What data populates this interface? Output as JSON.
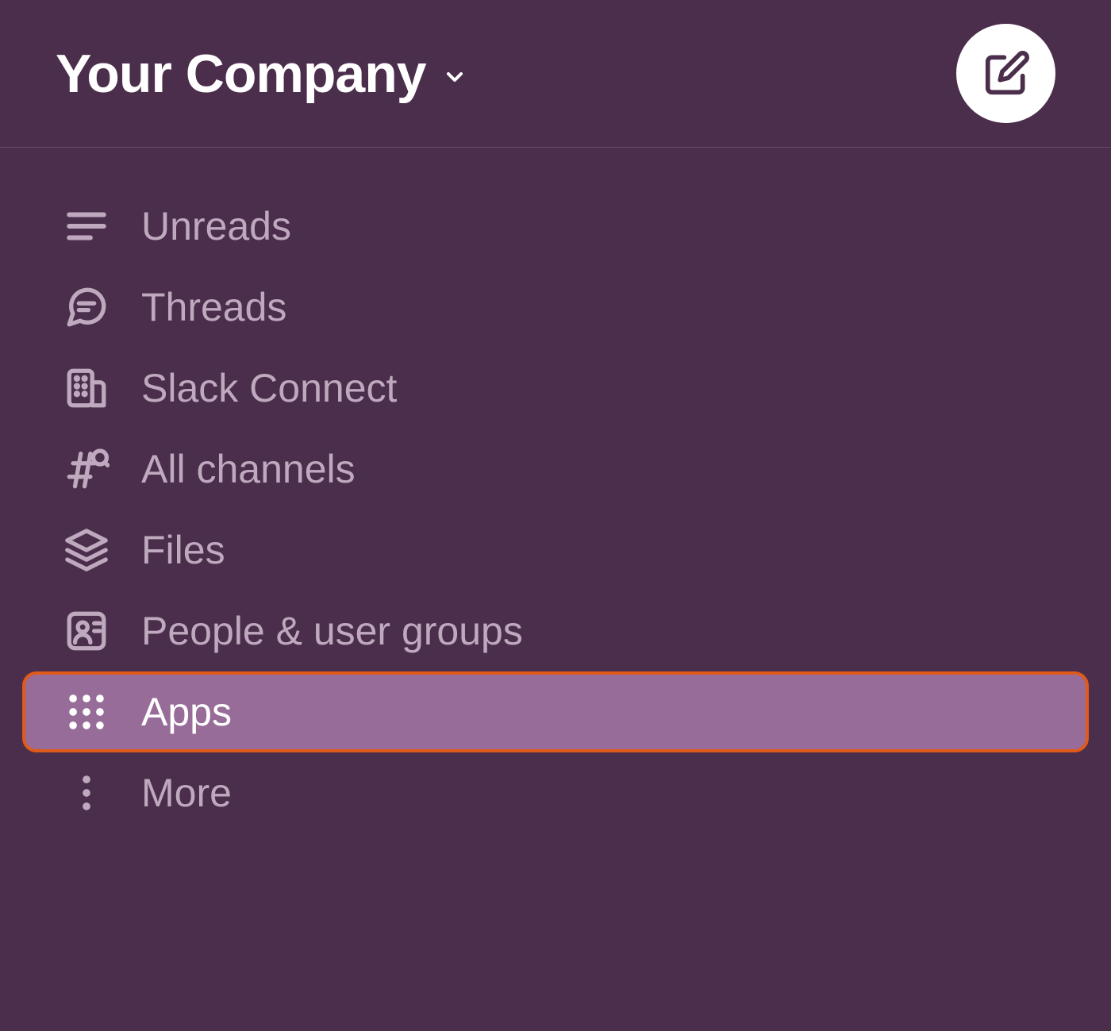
{
  "header": {
    "workspace_name": "Your Company"
  },
  "sidebar": {
    "items": [
      {
        "label": "Unreads",
        "icon": "unreads-icon",
        "selected": false
      },
      {
        "label": "Threads",
        "icon": "threads-icon",
        "selected": false
      },
      {
        "label": "Slack Connect",
        "icon": "building-icon",
        "selected": false
      },
      {
        "label": "All channels",
        "icon": "channels-icon",
        "selected": false
      },
      {
        "label": "Files",
        "icon": "files-icon",
        "selected": false
      },
      {
        "label": "People & user groups",
        "icon": "people-icon",
        "selected": false
      },
      {
        "label": "Apps",
        "icon": "apps-icon",
        "selected": true
      },
      {
        "label": "More",
        "icon": "more-icon",
        "selected": false
      }
    ]
  },
  "colors": {
    "background": "#4b2e4b",
    "text_muted": "#bfa9bf",
    "text": "#ffffff",
    "selected_bg": "#986c98",
    "highlight_border": "#e05a1c"
  }
}
